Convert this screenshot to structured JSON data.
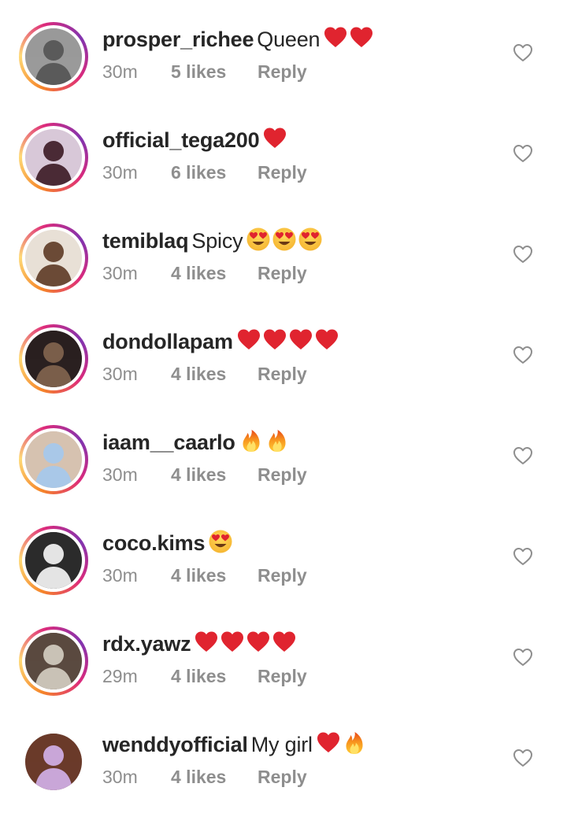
{
  "comments": [
    {
      "username": "prosper_richee",
      "text": "Queen",
      "emojis": [
        "heart",
        "heart"
      ],
      "time": "30m",
      "likes": "5 likes",
      "reply": "Reply",
      "story_ring": true,
      "avatar_colors": [
        "#5a5a5a",
        "#9a9a9a"
      ]
    },
    {
      "username": "official_tega200",
      "text": "",
      "emojis": [
        "heart"
      ],
      "time": "30m",
      "likes": "6 likes",
      "reply": "Reply",
      "story_ring": true,
      "avatar_colors": [
        "#4a2a35",
        "#d8c8d8"
      ]
    },
    {
      "username": "temiblaq",
      "text": "Spicy",
      "emojis": [
        "heart-eyes",
        "heart-eyes",
        "heart-eyes"
      ],
      "time": "30m",
      "likes": "4 likes",
      "reply": "Reply",
      "story_ring": true,
      "avatar_colors": [
        "#6b4a36",
        "#e8e0d6"
      ]
    },
    {
      "username": "dondollapam",
      "text": "",
      "emojis": [
        "heart",
        "heart",
        "heart",
        "heart"
      ],
      "time": "30m",
      "likes": "4 likes",
      "reply": "Reply",
      "story_ring": true,
      "avatar_colors": [
        "#7a5e4a",
        "#2a2020"
      ]
    },
    {
      "username": "iaam__caarlo",
      "text": "",
      "emojis": [
        "fire",
        "fire"
      ],
      "time": "30m",
      "likes": "4 likes",
      "reply": "Reply",
      "story_ring": true,
      "avatar_colors": [
        "#a9c8e8",
        "#d6c2b0"
      ]
    },
    {
      "username": "coco.kims",
      "text": "",
      "emojis": [
        "heart-eyes"
      ],
      "time": "30m",
      "likes": "4 likes",
      "reply": "Reply",
      "story_ring": true,
      "avatar_colors": [
        "#e4e4e4",
        "#2b2b2b"
      ]
    },
    {
      "username": "rdx.yawz",
      "text": "",
      "emojis": [
        "heart",
        "heart",
        "heart",
        "heart"
      ],
      "time": "29m",
      "likes": "4 likes",
      "reply": "Reply",
      "story_ring": true,
      "avatar_colors": [
        "#c9c2b6",
        "#5a4a40"
      ]
    },
    {
      "username": "wenddyofficial",
      "text": "My girl",
      "emojis": [
        "heart",
        "fire"
      ],
      "time": "30m",
      "likes": "4 likes",
      "reply": "Reply",
      "story_ring": false,
      "avatar_colors": [
        "#c9a6d8",
        "#6a3a2a"
      ]
    }
  ],
  "icons": {
    "like": "heart-outline-icon"
  },
  "colors": {
    "text": "#262626",
    "meta": "#8e8e8e",
    "heart": "#e0242f",
    "fire": "#f7931e"
  }
}
